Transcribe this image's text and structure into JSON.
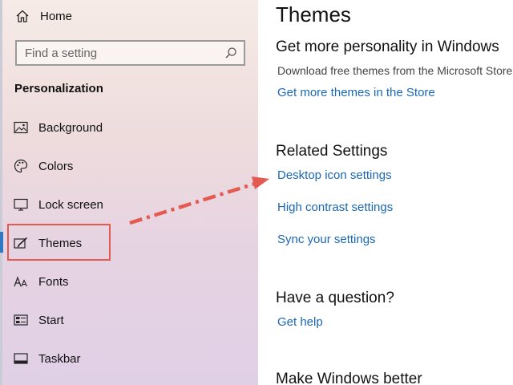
{
  "sidebar": {
    "home_label": "Home",
    "search_placeholder": "Find a setting",
    "section_title": "Personalization",
    "items": [
      {
        "label": "Background",
        "icon": "image-icon"
      },
      {
        "label": "Colors",
        "icon": "palette-icon"
      },
      {
        "label": "Lock screen",
        "icon": "monitor-icon"
      },
      {
        "label": "Themes",
        "icon": "brush-icon",
        "selected": true
      },
      {
        "label": "Fonts",
        "icon": "font-icon"
      },
      {
        "label": "Start",
        "icon": "start-icon"
      },
      {
        "label": "Taskbar",
        "icon": "taskbar-icon"
      }
    ]
  },
  "main": {
    "title": "Themes",
    "personality_heading": "Get more personality in Windows",
    "personality_desc": "Download free themes from the Microsoft Store",
    "store_link": "Get more themes in the Store",
    "related_heading": "Related Settings",
    "related_links": [
      "Desktop icon settings",
      "High contrast settings",
      "Sync your settings"
    ],
    "question_heading": "Have a question?",
    "help_link": "Get help",
    "better_heading": "Make Windows better"
  },
  "colors": {
    "accent": "#2f78c4",
    "link": "#1a67b6",
    "annotation": "#e35a52"
  }
}
